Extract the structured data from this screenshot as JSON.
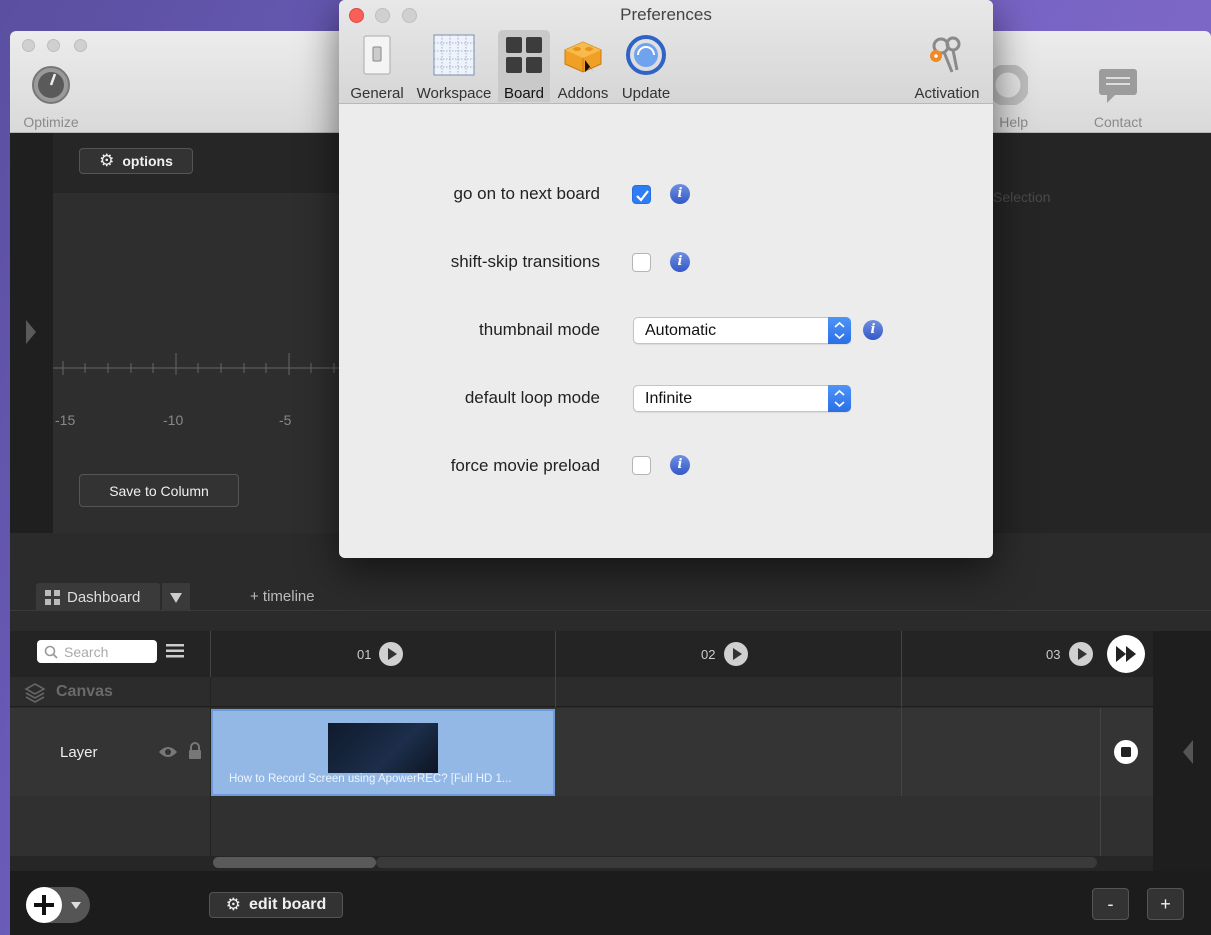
{
  "main_toolbar": {
    "optimize_label": "Optimize",
    "help_label": "Help",
    "contact_label": "Contact"
  },
  "left_panel": {
    "options_label": "options",
    "ruler_labels": [
      "-15",
      "-10",
      "-5"
    ],
    "save_column_label": "Save to Column",
    "selection_text": "Selection"
  },
  "timeline": {
    "dashboard_tab": "Dashboard",
    "add_timeline": "+ timeline",
    "search_placeholder": "Search",
    "board_numbers": [
      "01",
      "02",
      "03"
    ],
    "canvas_label": "Canvas",
    "layer_label": "Layer",
    "clip_title": "How to Record Screen using ApowerREC? [Full HD 1..."
  },
  "bottom": {
    "edit_board_label": "edit board",
    "zoom_out_label": "-",
    "zoom_in_label": "+"
  },
  "prefs": {
    "title": "Preferences",
    "tabs": [
      {
        "label": "General"
      },
      {
        "label": "Workspace"
      },
      {
        "label": "Board"
      },
      {
        "label": "Addons"
      },
      {
        "label": "Update"
      },
      {
        "label": "Activation"
      }
    ],
    "active_tab": "Board",
    "rows": {
      "next_board": {
        "label": "go on to next board",
        "checked": true
      },
      "shift_skip": {
        "label": "shift-skip transitions",
        "checked": false
      },
      "thumbnail": {
        "label": "thumbnail mode",
        "value": "Automatic"
      },
      "loop": {
        "label": "default loop mode",
        "value": "Infinite"
      },
      "preload": {
        "label": "force movie preload",
        "checked": false
      }
    },
    "info_glyph": "i"
  },
  "colors": {
    "accent": "#2f7df6",
    "clip_blue": "#93b8e6",
    "close_red": "#fc5f57"
  }
}
